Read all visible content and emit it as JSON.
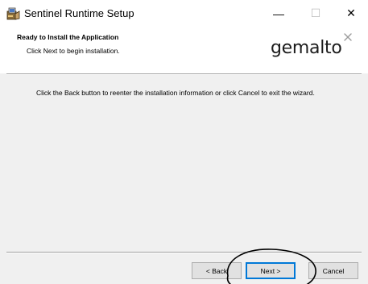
{
  "window": {
    "title": "Sentinel Runtime Setup"
  },
  "titlebar": {
    "min_glyph": "—",
    "max_glyph": "☐",
    "close_glyph": "✕",
    "icon": "setup-installer-icon"
  },
  "header": {
    "title": "Ready to Install the Application",
    "subtitle": "Click Next to begin installation.",
    "logo_text": "gemalto",
    "logo_mark": "×"
  },
  "body": {
    "message": "Click the Back button to reenter the installation information or click Cancel to exit the wizard."
  },
  "buttons": {
    "back": "< Back",
    "next": "Next >",
    "cancel": "Cancel"
  },
  "colors": {
    "dialog_bg": "#f0f0f0",
    "header_bg": "#ffffff",
    "default_button_border": "#0078d7"
  }
}
